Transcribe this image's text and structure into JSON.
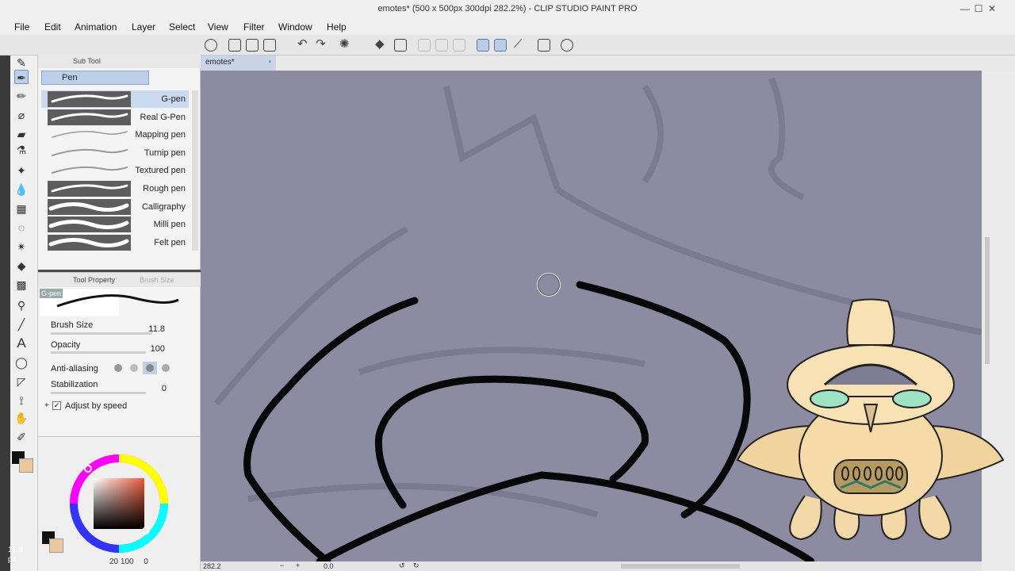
{
  "window": {
    "title": "emotes* (500 x 500px 300dpi 282.2%) - CLIP STUDIO PAINT PRO",
    "minimize": "—",
    "maximize": "☐",
    "close": "✕"
  },
  "menu": [
    "File",
    "Edit",
    "Animation",
    "Layer",
    "Select",
    "View",
    "Filter",
    "Window",
    "Help"
  ],
  "subtool": {
    "panel_label": "Sub Tool",
    "group_tab": "Pen",
    "brushes": [
      {
        "name": "G-pen",
        "selected": true
      },
      {
        "name": "Real G-Pen",
        "selected": false
      },
      {
        "name": "Mapping pen",
        "selected": false
      },
      {
        "name": "Turnip pen",
        "selected": false
      },
      {
        "name": "Textured pen",
        "selected": false
      },
      {
        "name": "Rough pen",
        "selected": false
      },
      {
        "name": "Calligraphy",
        "selected": false
      },
      {
        "name": "Milli pen",
        "selected": false
      },
      {
        "name": "Felt pen",
        "selected": false
      }
    ]
  },
  "tool_property": {
    "panel_label": "Tool Property",
    "inactive_tab": "Brush Size",
    "preview_label": "G-pen",
    "brush_size_label": "Brush Size",
    "brush_size_value": "11.8",
    "opacity_label": "Opacity",
    "opacity_value": "100",
    "antialiasing_label": "Anti-aliasing",
    "stabilization_label": "Stabilization",
    "stabilization_value": "0",
    "adjust_by_speed_label": "Adjust by speed",
    "adjust_by_speed_checked": true
  },
  "color": {
    "main_color": "#111111",
    "sub_color": "#e9c99b",
    "hue_marker": "#e8573a",
    "readout_a": "20",
    "readout_b": "100",
    "readout_c": "0"
  },
  "brush_size_badge": {
    "value": "11.8",
    "unit": "px"
  },
  "document": {
    "tab_label": "emotes*",
    "zoom": "282.2",
    "rotation": "0.0"
  }
}
